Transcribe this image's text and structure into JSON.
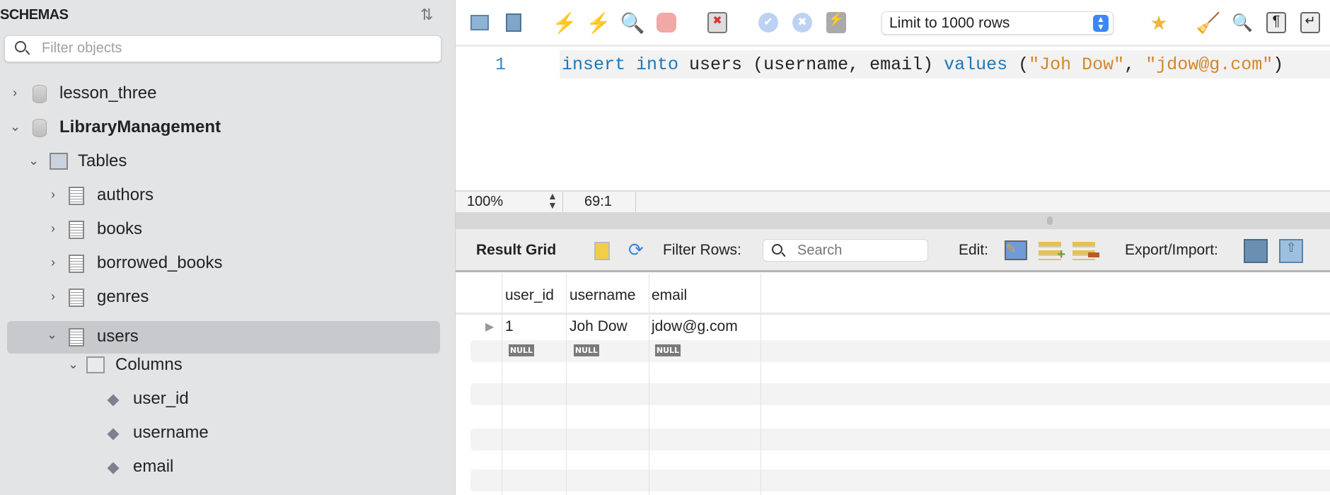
{
  "sidebar": {
    "title": "SCHEMAS",
    "filter_placeholder": "Filter objects",
    "tree": [
      {
        "label": "lesson_three",
        "expanded": false
      },
      {
        "label": "LibraryManagement",
        "expanded": true
      },
      {
        "label": "Tables"
      },
      {
        "label": "authors"
      },
      {
        "label": "books"
      },
      {
        "label": "borrowed_books"
      },
      {
        "label": "genres"
      },
      {
        "label": "users",
        "selected": true
      },
      {
        "label": "Columns"
      },
      {
        "label": "user_id"
      },
      {
        "label": "username"
      },
      {
        "label": "email"
      }
    ]
  },
  "toolbar": {
    "limit_select": "Limit to 1000 rows"
  },
  "editor": {
    "line_number": "1",
    "code": {
      "kw1": "insert",
      "kw2": "into",
      "t1": " users (username, email) ",
      "kw3": "values",
      "t2": " (",
      "s1": "\"Joh Dow\"",
      "t3": ", ",
      "s2": "\"jdow@g.com\"",
      "t4": ")"
    }
  },
  "status": {
    "zoom": "100%",
    "cursor": "69:1"
  },
  "result": {
    "title": "Result Grid",
    "filter_label": "Filter Rows:",
    "search_placeholder": "Search",
    "edit_label": "Edit:",
    "export_label": "Export/Import:",
    "columns": [
      "user_id",
      "username",
      "email"
    ],
    "rows": [
      [
        "1",
        "Joh Dow",
        "jdow@g.com"
      ]
    ],
    "null_row": [
      "NULL",
      "NULL",
      "NULL"
    ]
  }
}
